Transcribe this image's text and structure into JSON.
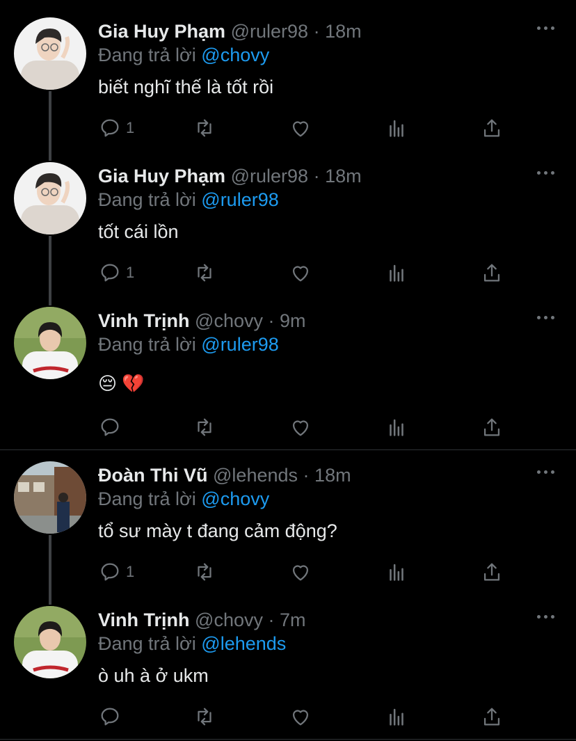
{
  "ui": {
    "reply_prefix": "Đang trả lời",
    "dot": "·"
  },
  "tweets": [
    {
      "name": "Gia Huy Phạm",
      "handle": "@ruler98",
      "time": "18m",
      "reply_to": "@chovy",
      "text": "biết nghĩ thế là tốt rồi",
      "replies": "1",
      "avatar": "gia-huy-avatar"
    },
    {
      "name": "Gia Huy Phạm",
      "handle": "@ruler98",
      "time": "18m",
      "reply_to": "@ruler98",
      "text": "tốt cái lồn",
      "replies": "1",
      "avatar": "gia-huy-avatar"
    },
    {
      "name": "Vinh Trịnh",
      "handle": "@chovy",
      "time": "9m",
      "reply_to": "@ruler98",
      "text": "😔 💔",
      "replies": "",
      "avatar": "vinh-trinh-avatar"
    },
    {
      "name": "Đoàn Thi Vũ",
      "handle": "@lehends",
      "time": "18m",
      "reply_to": "@chovy",
      "text": "tổ sư mày t đang cảm động?",
      "replies": "1",
      "avatar": "doan-thi-vu-avatar"
    },
    {
      "name": "Vinh Trịnh",
      "handle": "@chovy",
      "time": "7m",
      "reply_to": "@lehends",
      "text": "ò uh à ở ukm",
      "replies": "",
      "avatar": "vinh-trinh-avatar"
    }
  ],
  "icons": {
    "reply": "reply-icon",
    "retweet": "retweet-icon",
    "like": "heart-icon",
    "stats": "stats-icon",
    "share": "share-icon",
    "more": "more-icon"
  },
  "colors": {
    "background": "#000000",
    "text": "#e7e9ea",
    "muted": "#71767b",
    "link": "#1d9bf0",
    "thread_line": "#3e4144",
    "divider": "#2f3336"
  }
}
